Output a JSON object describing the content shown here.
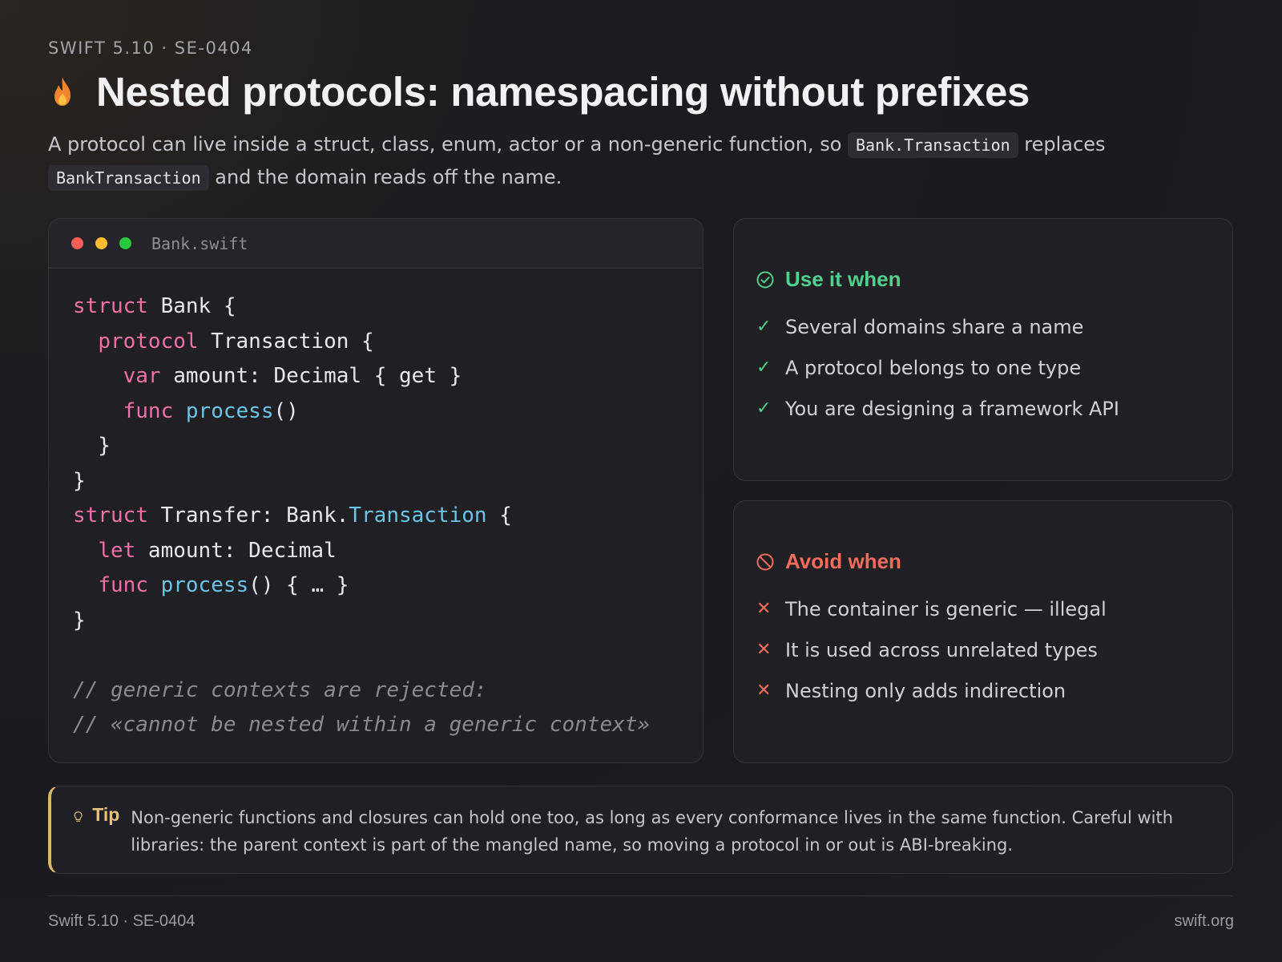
{
  "header": {
    "eyebrow": "SWIFT 5.10 · SE-0404",
    "title": "Nested protocols: namespacing without prefixes",
    "subtitle_before": "A protocol can live inside a struct, class, enum, actor or a non-generic function, so ",
    "code_a": "Bank.Transaction",
    "subtitle_middle": " replaces ",
    "code_b": "BankTransaction",
    "subtitle_after": " and the domain reads off the name."
  },
  "code_card": {
    "file_name": "Bank.swift",
    "dot_colors": [
      "#ff5f56",
      "#ffbd2e",
      "#27c93f"
    ]
  },
  "use_card": {
    "heading": "Use it when",
    "items": [
      "Several domains share a name",
      "A protocol belongs to one type",
      "You are designing a framework API"
    ],
    "color": "#4fd18b"
  },
  "avoid_card": {
    "heading": "Avoid when",
    "items": [
      "The container is generic — illegal",
      "It is used across unrelated types",
      "Nesting only adds indirection"
    ],
    "color": "#f26b5b"
  },
  "tip": {
    "label": "Tip",
    "text": "Non-generic functions and closures can hold one too, as long as every conformance lives in the same function. Careful with libraries: the parent context is part of the mangled name, so moving a protocol in or out is ABI-breaking."
  },
  "footer": {
    "left": "Swift 5.10 · SE-0404",
    "right": "swift.org"
  }
}
